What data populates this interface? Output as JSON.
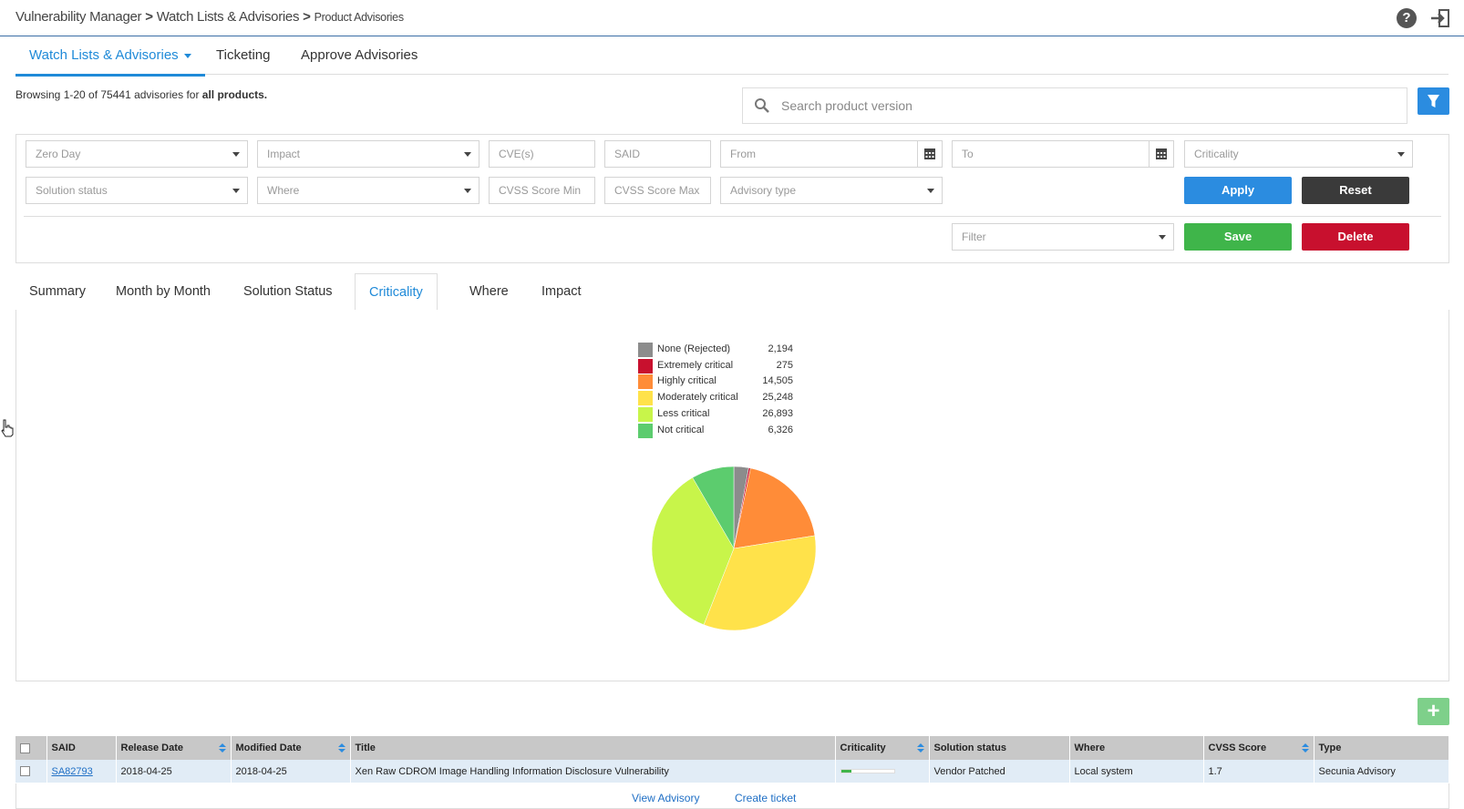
{
  "breadcrumb": {
    "root": "Vulnerability Manager",
    "section": "Watch Lists & Advisories",
    "page": "Product Advisories",
    "separator": ">"
  },
  "header_icons": [
    "help-icon",
    "logout-icon"
  ],
  "nav": {
    "tabs": [
      {
        "label": "Watch Lists & Advisories",
        "active": true
      },
      {
        "label": "Ticketing",
        "active": false
      },
      {
        "label": "Approve Advisories",
        "active": false
      }
    ]
  },
  "browsing": {
    "prefix": "Browsing 1-20 of 75441 advisories for",
    "scope": "all products."
  },
  "search": {
    "placeholder": "Search product version"
  },
  "filters": {
    "zero_day": "Zero Day",
    "impact": "Impact",
    "cves": "CVE(s)",
    "said": "SAID",
    "from": "From",
    "to": "To",
    "criticality": "Criticality",
    "solution_status": "Solution status",
    "where": "Where",
    "cvss_min": "CVSS Score Min",
    "cvss_max": "CVSS Score Max",
    "advisory_type": "Advisory type",
    "saved_filter": "Filter",
    "apply_label": "Apply",
    "reset_label": "Reset",
    "save_label": "Save",
    "delete_label": "Delete"
  },
  "chart_tabs": [
    {
      "label": "Summary",
      "active": false
    },
    {
      "label": "Month by Month",
      "active": false
    },
    {
      "label": "Solution Status",
      "active": false
    },
    {
      "label": "Criticality",
      "active": true
    },
    {
      "label": "Where",
      "active": false
    },
    {
      "label": "Impact",
      "active": false
    }
  ],
  "chart_data": {
    "type": "pie",
    "title": "",
    "legend_position": "top",
    "categories": [
      "None (Rejected)",
      "Extremely critical",
      "Highly critical",
      "Moderately critical",
      "Less critical",
      "Not critical"
    ],
    "values": [
      2194,
      275,
      14505,
      25248,
      26893,
      6326
    ],
    "value_labels": [
      "2,194",
      "275",
      "14,505",
      "25,248",
      "26,893",
      "6,326"
    ],
    "colors": [
      "#8c8c8c",
      "#c8102e",
      "#ff8c38",
      "#ffe24a",
      "#c8f54a",
      "#5ccc6e"
    ]
  },
  "table": {
    "columns": [
      "SAID",
      "Release Date",
      "Modified Date",
      "Title",
      "Criticality",
      "Solution status",
      "Where",
      "CVSS Score",
      "Type"
    ],
    "rows": [
      {
        "said": "SA82793",
        "release_date": "2018-04-25",
        "modified_date": "2018-04-25",
        "title": "Xen Raw CDROM Image Handling Information Disclosure Vulnerability",
        "criticality_level": 0.2,
        "solution_status": "Vendor Patched",
        "where": "Local system",
        "cvss": "1.7",
        "type": "Secunia Advisory"
      }
    ],
    "row_actions": {
      "view": "View Advisory",
      "ticket": "Create ticket"
    }
  }
}
